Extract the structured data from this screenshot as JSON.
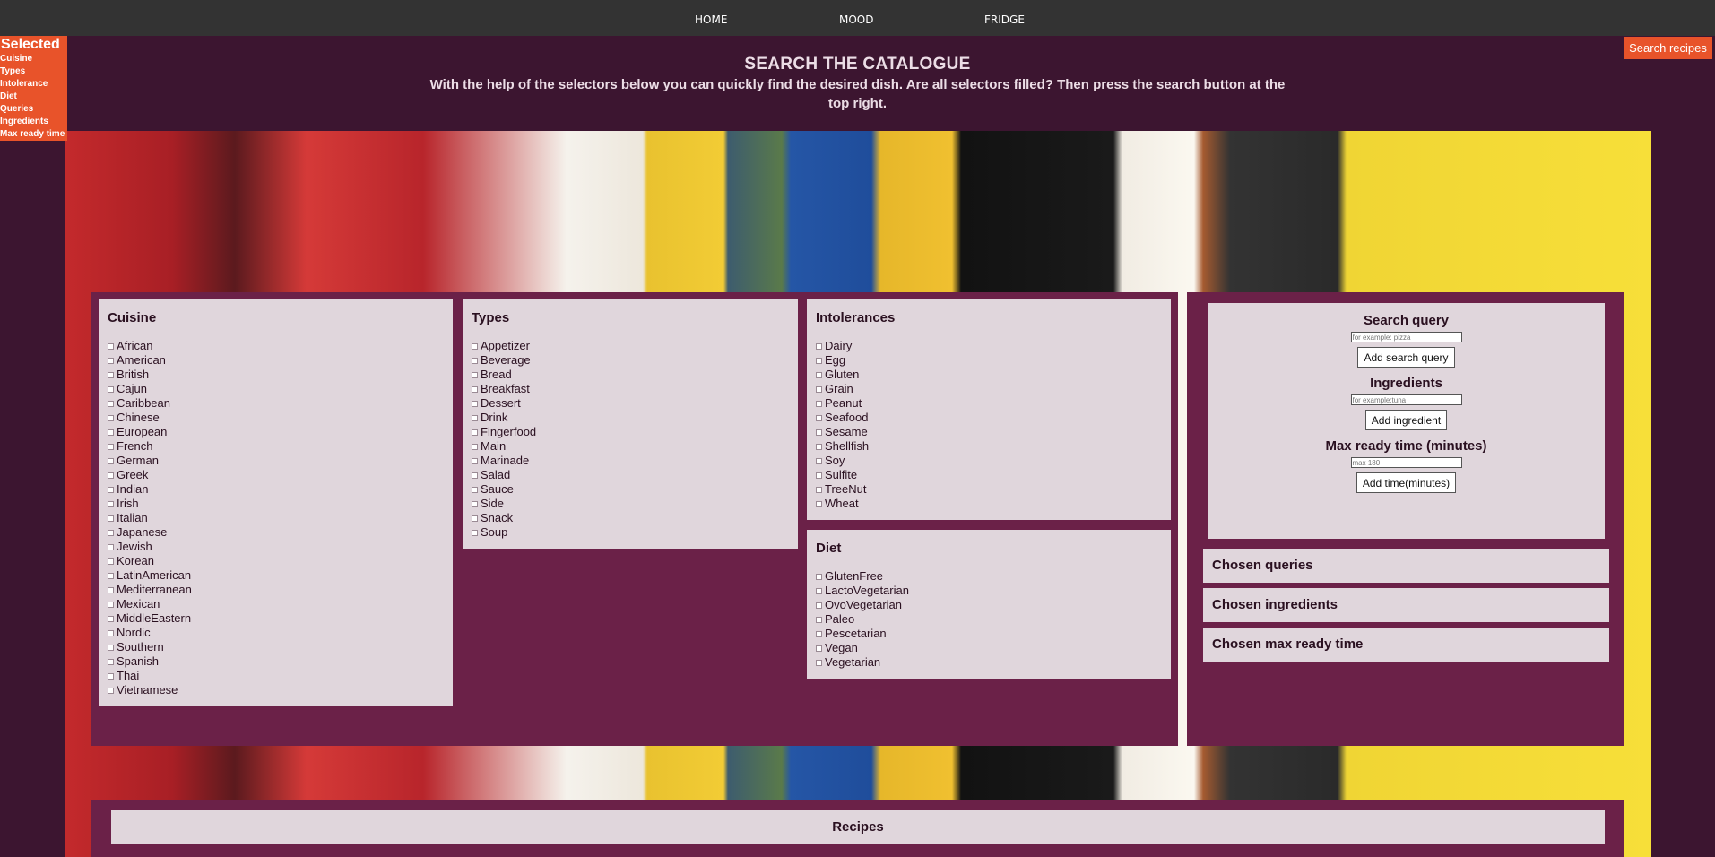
{
  "nav": {
    "items": [
      "HOME",
      "MOOD",
      "FRIDGE"
    ]
  },
  "selected": {
    "title": "Selected",
    "items": [
      "Cuisine",
      "Types",
      "Intolerance",
      "Diet",
      "Queries",
      "Ingredients",
      "Max ready time"
    ]
  },
  "search_button": "Search recipes",
  "header": {
    "title": "SEARCH THE CATALOGUE",
    "subtitle": "With the help of the selectors below you can quickly find the desired dish. Are all selectors filled? Then press the search button at the top right."
  },
  "cuisine": {
    "title": "Cuisine",
    "options": [
      "African",
      "American",
      "British",
      "Cajun",
      "Caribbean",
      "Chinese",
      "European",
      "French",
      "German",
      "Greek",
      "Indian",
      "Irish",
      "Italian",
      "Japanese",
      "Jewish",
      "Korean",
      "LatinAmerican",
      "Mediterranean",
      "Mexican",
      "MiddleEastern",
      "Nordic",
      "Southern",
      "Spanish",
      "Thai",
      "Vietnamese"
    ]
  },
  "types": {
    "title": "Types",
    "options": [
      "Appetizer",
      "Beverage",
      "Bread",
      "Breakfast",
      "Dessert",
      "Drink",
      "Fingerfood",
      "Main",
      "Marinade",
      "Salad",
      "Sauce",
      "Side",
      "Snack",
      "Soup"
    ]
  },
  "intolerances": {
    "title": "Intolerances",
    "options": [
      "Dairy",
      "Egg",
      "Gluten",
      "Grain",
      "Peanut",
      "Seafood",
      "Sesame",
      "Shellfish",
      "Soy",
      "Sulfite",
      "TreeNut",
      "Wheat"
    ]
  },
  "diet": {
    "title": "Diet",
    "options": [
      "GlutenFree",
      "LactoVegetarian",
      "OvoVegetarian",
      "Paleo",
      "Pescetarian",
      "Vegan",
      "Vegetarian"
    ]
  },
  "form": {
    "query_label": "Search query",
    "query_placeholder": "for example: pizza",
    "query_button": "Add search query",
    "ingredients_label": "Ingredients",
    "ingredients_placeholder": "for example:tuna",
    "ingredients_button": "Add ingredient",
    "time_label": "Max ready time (minutes)",
    "time_placeholder": "max 180",
    "time_button": "Add time(minutes)"
  },
  "chosen": {
    "queries": "Chosen queries",
    "ingredients": "Chosen ingredients",
    "time": "Chosen max ready time"
  },
  "recipes": {
    "title": "Recipes"
  },
  "colors": {
    "accent": "#e8532a",
    "panel": "#6b2148",
    "card": "#e0d6dc",
    "background": "#3c1530",
    "nav": "#333333"
  }
}
